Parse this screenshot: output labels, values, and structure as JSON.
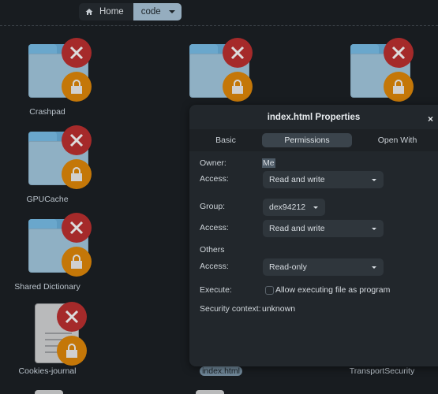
{
  "pathbar": {
    "home_label": "Home",
    "current_label": "code"
  },
  "files": [
    {
      "name": "Crashpad",
      "type": "folder",
      "emblems": [
        "unreadable-x",
        "locked"
      ]
    },
    {
      "name": "",
      "type": "folder",
      "emblems": [
        "unreadable-x",
        "locked"
      ]
    },
    {
      "name": "",
      "type": "folder",
      "emblems": [
        "unreadable-x",
        "locked"
      ]
    },
    {
      "name": "GPUCache",
      "type": "folder",
      "emblems": [
        "unreadable-x",
        "locked"
      ]
    },
    {
      "name": "Shared Dictionary",
      "type": "folder",
      "emblems": [
        "unreadable-x",
        "locked"
      ]
    },
    {
      "name": "Cookies-journal",
      "type": "document",
      "emblems": [
        "unreadable-x",
        "locked"
      ]
    },
    {
      "name": "index.html",
      "type": "document",
      "selected": true
    },
    {
      "name": "TransportSecurity",
      "type": "document"
    }
  ],
  "dialog": {
    "title": "index.html Properties",
    "close_label": "×",
    "tabs": [
      "Basic",
      "Permissions",
      "Open With"
    ],
    "active_tab": "Permissions",
    "owner_label": "Owner:",
    "owner_value": "Me",
    "owner_access_label": "Access:",
    "owner_access_value": "Read and write",
    "group_label": "Group:",
    "group_value": "dex94212",
    "group_access_label": "Access:",
    "group_access_value": "Read and write",
    "others_heading": "Others",
    "others_access_label": "Access:",
    "others_access_value": "Read-only",
    "execute_label": "Execute:",
    "execute_checkbox_label": "Allow executing file as program",
    "execute_checked": false,
    "security_label": "Security context:",
    "security_value": "unknown"
  }
}
